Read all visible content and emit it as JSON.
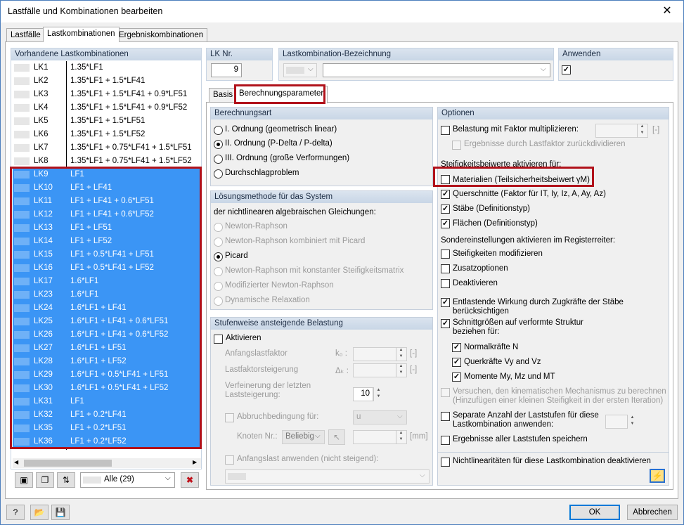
{
  "window": {
    "title": "Lastfälle und Kombinationen bearbeiten",
    "close": "✕"
  },
  "tabs": [
    "Lastfälle",
    "Lastkombinationen",
    "Ergebniskombinationen"
  ],
  "left": {
    "header": "Vorhandene Lastkombinationen",
    "rows": [
      {
        "name": "LK1",
        "formula": "1.35*LF1",
        "selected": false
      },
      {
        "name": "LK2",
        "formula": "1.35*LF1 + 1.5*LF41",
        "selected": false
      },
      {
        "name": "LK3",
        "formula": "1.35*LF1 + 1.5*LF41 + 0.9*LF51",
        "selected": false
      },
      {
        "name": "LK4",
        "formula": "1.35*LF1 + 1.5*LF41 + 0.9*LF52",
        "selected": false
      },
      {
        "name": "LK5",
        "formula": "1.35*LF1 + 1.5*LF51",
        "selected": false
      },
      {
        "name": "LK6",
        "formula": "1.35*LF1 + 1.5*LF52",
        "selected": false
      },
      {
        "name": "LK7",
        "formula": "1.35*LF1 + 0.75*LF41 + 1.5*LF51",
        "selected": false
      },
      {
        "name": "LK8",
        "formula": "1.35*LF1 + 0.75*LF41 + 1.5*LF52",
        "selected": false
      },
      {
        "name": "LK9",
        "formula": "LF1",
        "selected": true
      },
      {
        "name": "LK10",
        "formula": "LF1 + LF41",
        "selected": true
      },
      {
        "name": "LK11",
        "formula": "LF1 + LF41 + 0.6*LF51",
        "selected": true
      },
      {
        "name": "LK12",
        "formula": "LF1 + LF41 + 0.6*LF52",
        "selected": true
      },
      {
        "name": "LK13",
        "formula": "LF1 + LF51",
        "selected": true
      },
      {
        "name": "LK14",
        "formula": "LF1 + LF52",
        "selected": true
      },
      {
        "name": "LK15",
        "formula": "LF1 + 0.5*LF41 + LF51",
        "selected": true
      },
      {
        "name": "LK16",
        "formula": "LF1 + 0.5*LF41 + LF52",
        "selected": true
      },
      {
        "name": "LK17",
        "formula": "1.6*LF1",
        "selected": true
      },
      {
        "name": "LK23",
        "formula": "1.6*LF1",
        "selected": true
      },
      {
        "name": "LK24",
        "formula": "1.6*LF1 + LF41",
        "selected": true
      },
      {
        "name": "LK25",
        "formula": "1.6*LF1 + LF41 + 0.6*LF51",
        "selected": true
      },
      {
        "name": "LK26",
        "formula": "1.6*LF1 + LF41 + 0.6*LF52",
        "selected": true
      },
      {
        "name": "LK27",
        "formula": "1.6*LF1 + LF51",
        "selected": true
      },
      {
        "name": "LK28",
        "formula": "1.6*LF1 + LF52",
        "selected": true
      },
      {
        "name": "LK29",
        "formula": "1.6*LF1 + 0.5*LF41 + LF51",
        "selected": true
      },
      {
        "name": "LK30",
        "formula": "1.6*LF1 + 0.5*LF41 + LF52",
        "selected": true
      },
      {
        "name": "LK31",
        "formula": "LF1",
        "selected": true
      },
      {
        "name": "LK32",
        "formula": "LF1 + 0.2*LF41",
        "selected": true
      },
      {
        "name": "LK35",
        "formula": "LF1 + 0.2*LF51",
        "selected": true
      },
      {
        "name": "LK36",
        "formula": "LF1 + 0.2*LF52",
        "selected": true
      }
    ],
    "filter": "Alle (29)"
  },
  "top": {
    "lk_nr_label": "LK Nr.",
    "lk_nr_value": "9",
    "bez_label": "Lastkombination-Bezeichnung",
    "bez_value": "",
    "anwenden_label": "Anwenden",
    "anwenden_checked": "✓"
  },
  "subtabs": [
    "Basis",
    "Berechnungsparameter"
  ],
  "berechnungsart": {
    "header": "Berechnungsart",
    "options": [
      "I. Ordnung (geometrisch linear)",
      "II. Ordnung (P-Delta / P-delta)",
      "III. Ordnung (große Verformungen)",
      "Durchschlagproblem"
    ]
  },
  "loesung": {
    "header": "Lösungsmethode für das System",
    "intro": "der nichtlinearen algebraischen Gleichungen:",
    "options": [
      "Newton-Raphson",
      "Newton-Raphson kombiniert mit Picard",
      "Picard",
      "Newton-Raphson mit konstanter Steifigkeitsmatrix",
      "Modifizierter Newton-Raphson",
      "Dynamische Relaxation"
    ]
  },
  "stufen": {
    "header": "Stufenweise ansteigende Belastung",
    "aktivieren": "Aktivieren",
    "anfangs": "Anfangslastfaktor",
    "anfangs_sym": "k₀ :",
    "steig": "Lastfaktorsteigerung",
    "steig_sym": "Δₖ :",
    "unit": "[-]",
    "verf1": "Verfeinerung der letzten",
    "verf2": "Laststeigerung:",
    "verf_value": "10",
    "abbruch": "Abbruchbedingung für:",
    "abbruch_value": "u",
    "knoten": "Knoten Nr.:",
    "knoten_value": "Beliebig",
    "mm": "[mm]",
    "anfangslast": "Anfangslast anwenden (nicht steigend):"
  },
  "optionen": {
    "header": "Optionen",
    "faktor": "Belastung mit Faktor multiplizieren:",
    "faktor_unit": "[-]",
    "zurueck": "Ergebnisse durch Lastfaktor zurückdividieren",
    "steif_label": "Steifigkeitsbeiwerte aktivieren für:",
    "materialien": "Materialien (Teilsicherheitsbeiwert γM)",
    "querschnitte": "Querschnitte (Faktor für IT, Iy, Iz, A, Ay, Az)",
    "staebe": "Stäbe (Definitionstyp)",
    "flaechen": "Flächen (Definitionstyp)",
    "sonder": "Sondereinstellungen aktivieren im Registerreiter:",
    "steif_mod": "Steifigkeiten modifizieren",
    "zusatz": "Zusatzoptionen",
    "deakt": "Deaktivieren",
    "entl1": "Entlastende Wirkung durch Zugkräfte der Stäbe",
    "entl2": "berücksichtigen",
    "schnitt1": "Schnittgrößen auf verformte Struktur",
    "schnitt2": "beziehen für:",
    "normal": "Normalkräfte N",
    "quer": "Querkräfte Vy and Vz",
    "momente": "Momente My, Mz und MT",
    "versuch1": "Versuchen, den kinematischen Mechanismus zu berechnen",
    "versuch2": "(Hinzufügen einer kleinen Steifigkeit in der ersten Iteration)",
    "separate1": "Separate Anzahl der Laststufen für diese",
    "separate2": "Lastkombination anwenden:",
    "alle_stufen": "Ergebnisse aller Laststufen speichern",
    "nichtlin": "Nichtlinearitäten für diese Lastkombination deaktivieren"
  },
  "buttons": {
    "ok": "OK",
    "cancel": "Abbrechen"
  },
  "colors": {
    "selection": "#3b95f5",
    "highlight": "#b1121b",
    "header": "#c8d6e6"
  }
}
